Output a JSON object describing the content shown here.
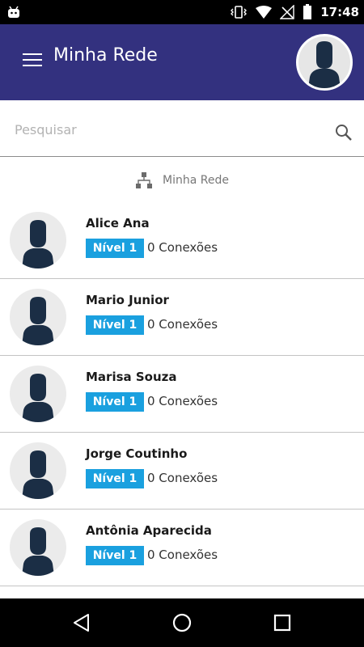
{
  "status_bar": {
    "time": "17:48",
    "icons": [
      "android-icon",
      "vibrate-icon",
      "wifi-icon",
      "no-signal-icon",
      "battery-icon"
    ]
  },
  "app_bar": {
    "title": "Minha Rede",
    "menu_icon": "hamburger-menu-icon",
    "avatar_icon": "user-silhouette-icon",
    "background_color": "#33317f"
  },
  "search": {
    "placeholder": "Pesquisar",
    "value": "",
    "icon": "search-icon"
  },
  "section": {
    "title": "Minha Rede",
    "icon": "network-icon"
  },
  "members": [
    {
      "name": "Alice Ana",
      "level": "Nível 1",
      "connections": "0 Conexões"
    },
    {
      "name": "Mario Junior",
      "level": "Nível 1",
      "connections": "0 Conexões"
    },
    {
      "name": "Marisa Souza",
      "level": "Nível 1",
      "connections": "0 Conexões"
    },
    {
      "name": "Jorge Coutinho",
      "level": "Nível 1",
      "connections": "0 Conexões"
    },
    {
      "name": "Antônia Aparecida",
      "level": "Nível 1",
      "connections": "0 Conexões"
    }
  ],
  "colors": {
    "badge": "#1aa0df",
    "avatar_silhouette": "#1b2e45"
  },
  "nav_bar": {
    "icons": [
      "back-icon",
      "home-icon",
      "recents-icon"
    ]
  }
}
